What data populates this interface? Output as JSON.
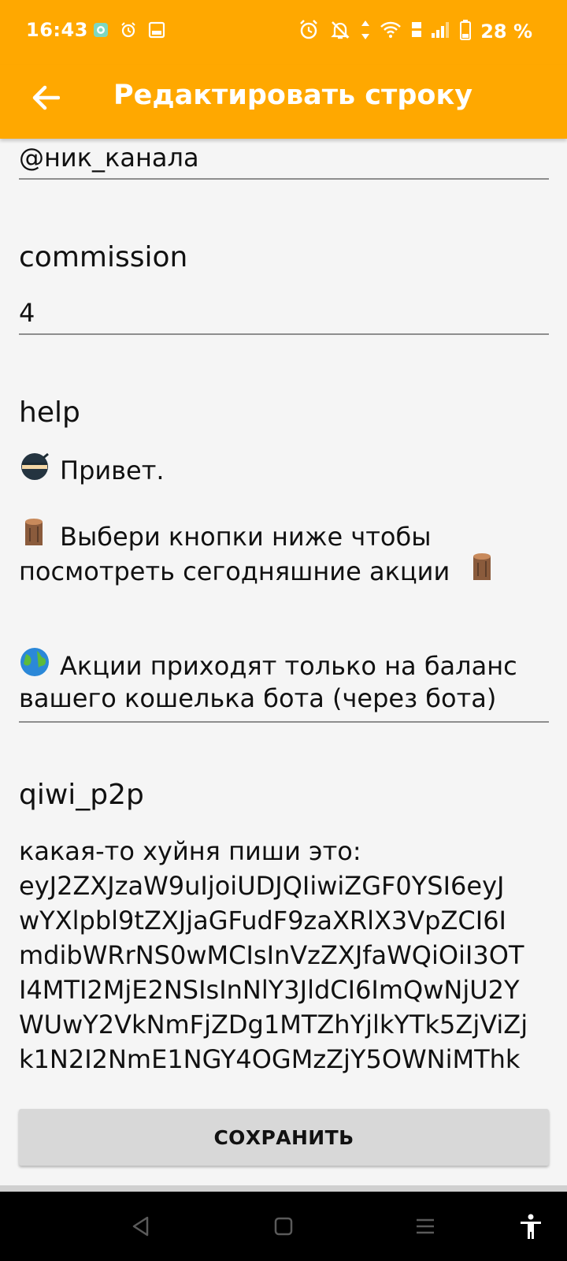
{
  "status_bar": {
    "time": "16:43",
    "battery": "28 %"
  },
  "app_bar": {
    "title": "Редактировать строку"
  },
  "fields": {
    "channel": {
      "value": "@ник_канала"
    },
    "commission": {
      "label": "commission",
      "value": "4"
    },
    "help": {
      "label": "help",
      "lines": [
        "Привет.",
        "Выбери кнопки ниже чтобы",
        "посмотреть сегодняшние акции",
        "Акции приходят только на баланс",
        "вашего кошелька бота (через бота)"
      ]
    },
    "qiwi": {
      "label": "qiwi_p2p",
      "lines": [
        "какая-то хуйня пиши это:",
        "eyJ2ZXJzaW9uIjoiUDJQIiwiZGF0YSI6eyJ",
        "wYXlpbl9tZXJjaGFudF9zaXRlX3VpZCI6I",
        "mdibWRrNS0wMCIsInVzZXJfaWQiOiI3OT",
        "I4MTI2MjE2NSIsInNlY3JldCI6ImQwNjU2Y",
        "WUwY2VkNmFjZDg1MTZhYjlkYTk5ZjViZj",
        "k1N2I2NmE1NGY4OGMzZjY5OWNiMThk"
      ]
    }
  },
  "save_button": {
    "label": "СОХРАНИТЬ"
  },
  "colors": {
    "accent": "#ffa800",
    "underline": "#8e8e8e",
    "button": "#d8d8d8"
  }
}
